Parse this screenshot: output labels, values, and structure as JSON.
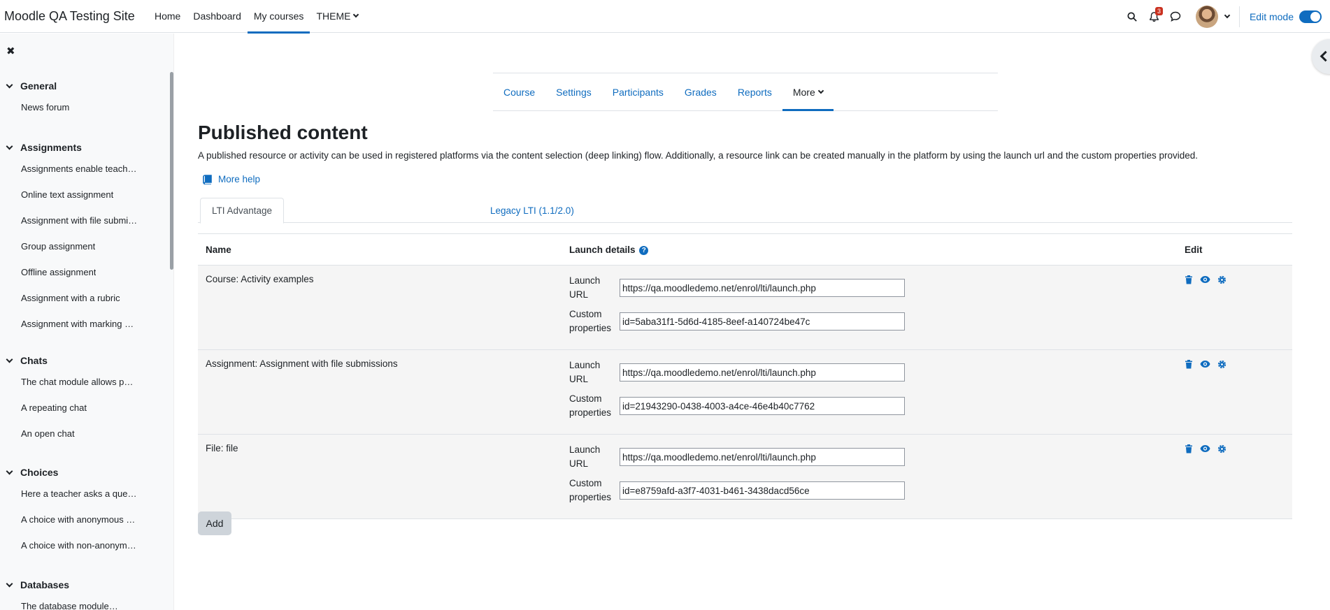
{
  "navbar": {
    "site_name": "Moodle QA Testing Site",
    "items": [
      {
        "label": "Home"
      },
      {
        "label": "Dashboard"
      },
      {
        "label": "My courses"
      },
      {
        "label": "THEME"
      }
    ],
    "active_item": "My courses",
    "notification_count": "3",
    "edit_mode_label": "Edit mode",
    "edit_mode_on": true
  },
  "course_index": {
    "sections": [
      {
        "title": "General",
        "items": [
          "News forum"
        ]
      },
      {
        "title": "Assignments",
        "items": [
          "Assignments enable teach…",
          "Online text assignment",
          "Assignment with file submi…",
          "Group assignment",
          "Offline assignment",
          "Assignment with a rubric",
          "Assignment with marking …"
        ]
      },
      {
        "title": "Chats",
        "items": [
          "The chat module allows p…",
          "A repeating chat",
          "An open chat"
        ]
      },
      {
        "title": "Choices",
        "items": [
          "Here a teacher asks a que…",
          "A choice with anonymous …",
          "A choice with non-anonym…"
        ]
      },
      {
        "title": "Databases",
        "items": [
          "The database module…"
        ]
      }
    ]
  },
  "secondary_nav": {
    "tabs": [
      "Course",
      "Settings",
      "Participants",
      "Grades",
      "Reports",
      "More"
    ],
    "active_tab": "More"
  },
  "page": {
    "title": "Published content",
    "description": "A published resource or activity can be used in registered platforms via the content selection (deep linking) flow. Additionally, a resource link can be created manually in the platform by using the launch url and the custom properties provided.",
    "more_help": "More help",
    "tabs": [
      "LTI Advantage",
      "Legacy LTI (1.1/2.0)"
    ],
    "active_tab": "LTI Advantage"
  },
  "table": {
    "headers": {
      "name": "Name",
      "launch_details": "Launch details",
      "edit": "Edit"
    },
    "launch_url_label_1": "Launch",
    "launch_url_label_2": "URL",
    "custom_label_1": "Custom",
    "custom_label_2": "properties",
    "rows": [
      {
        "name": "Course: Activity examples",
        "launch_url": "https://qa.moodledemo.net/enrol/lti/launch.php",
        "custom_properties": "id=5aba31f1-5d6d-4185-8eef-a140724be47c"
      },
      {
        "name": "Assignment: Assignment with file submissions",
        "launch_url": "https://qa.moodledemo.net/enrol/lti/launch.php",
        "custom_properties": "id=21943290-0438-4003-a4ce-46e4b40c7762"
      },
      {
        "name": "File: file",
        "launch_url": "https://qa.moodledemo.net/enrol/lti/launch.php",
        "custom_properties": "id=e8759afd-a3f7-4031-b461-3438dacd56ce"
      }
    ]
  },
  "add_button": "Add",
  "colors": {
    "accent": "#0f6cbf",
    "badge": "#ca3120"
  }
}
